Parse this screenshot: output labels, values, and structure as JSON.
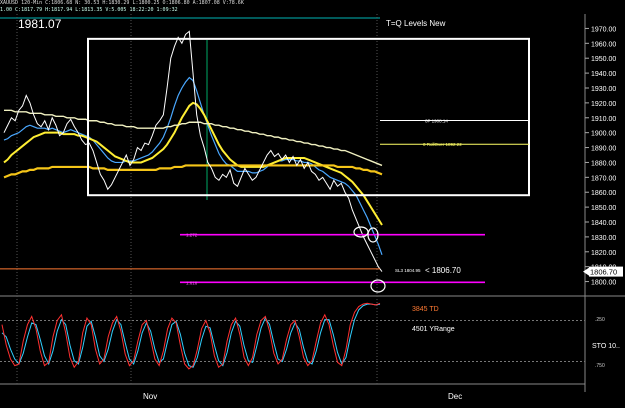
{
  "header": {
    "line1": "XAUUSD  120-Min  C:1806.68  N:  30.53  H:1830.29  L:1800.25  O:1806.80  A:1807.08  V:78.6K",
    "line2": "1.00  C:1817.79  H:1817.94  L:1813.35  V:5.005  18:22:20  1:09:32",
    "big_label": "1981.07",
    "title": "T=Q Levels New"
  },
  "colors": {
    "price": "#ffffff",
    "ma_fast": "#4aa8ff",
    "ma_mid": "#ffee33",
    "ma_slow": "#f5c518",
    "ma_long": "#f0f0c0",
    "fib_line": "#ff00ff",
    "zone_border": "#ffffff",
    "stoch_k": "#ff3030",
    "stoch_d": "#30d0ff"
  },
  "chart_data": {
    "type": "line",
    "y_axis": {
      "ticks": [
        "1970.00",
        "1960.00",
        "1950.00",
        "1940.00",
        "1930.00",
        "1920.00",
        "1910.00",
        "1900.00",
        "1890.00",
        "1880.00",
        "1870.00",
        "1860.00",
        "1850.00",
        "1840.00",
        "1830.00",
        "1820.00",
        "1810.00",
        "1800.00"
      ],
      "ylim": [
        1793,
        1977
      ]
    },
    "x_axis": {
      "ticks": [
        "Nov",
        "Dec"
      ]
    },
    "price_series": [
      1900,
      1905,
      1910,
      1908,
      1915,
      1918,
      1925,
      1920,
      1912,
      1906,
      1904,
      1908,
      1902,
      1910,
      1905,
      1898,
      1900,
      1906,
      1909,
      1904,
      1900,
      1895,
      1892,
      1893,
      1888,
      1880,
      1872,
      1868,
      1862,
      1865,
      1870,
      1875,
      1880,
      1885,
      1878,
      1882,
      1890,
      1888,
      1893,
      1892,
      1898,
      1905,
      1908,
      1912,
      1930,
      1950,
      1958,
      1964,
      1960,
      1966,
      1968,
      1940,
      1912,
      1898,
      1890,
      1880,
      1876,
      1870,
      1868,
      1872,
      1870,
      1875,
      1866,
      1864,
      1870,
      1876,
      1872,
      1868,
      1870,
      1875,
      1880,
      1885,
      1888,
      1884,
      1886,
      1882,
      1885,
      1880,
      1884,
      1878,
      1882,
      1876,
      1880,
      1874,
      1872,
      1868,
      1870,
      1866,
      1862,
      1868,
      1864,
      1866,
      1860,
      1856,
      1848,
      1842,
      1836,
      1830,
      1825,
      1820,
      1815,
      1810,
      1806.7
    ],
    "series": [
      {
        "name": "",
        "values": [
          1895,
          1896,
          1898,
          1899,
          1900,
          1902,
          1904,
          1905,
          1904,
          1903,
          1903,
          1903,
          1902,
          1903,
          1902,
          1901,
          1900,
          1901,
          1902,
          1901,
          1900,
          1899,
          1898,
          1897,
          1895,
          1892,
          1889,
          1886,
          1883,
          1881,
          1880,
          1880,
          1880,
          1881,
          1881,
          1881,
          1882,
          1883,
          1884,
          1885,
          1887,
          1890,
          1893,
          1897,
          1903,
          1910,
          1918,
          1925,
          1930,
          1934,
          1937,
          1935,
          1928,
          1920,
          1912,
          1905,
          1898,
          1892,
          1886,
          1882,
          1879,
          1878,
          1876,
          1874,
          1874,
          1874,
          1874,
          1873,
          1873,
          1874,
          1875,
          1877,
          1879,
          1880,
          1881,
          1881,
          1882,
          1882,
          1882,
          1881,
          1881,
          1880,
          1880,
          1879,
          1877,
          1875,
          1874,
          1872,
          1870,
          1869,
          1868,
          1867,
          1866,
          1864,
          1861,
          1858,
          1853,
          1848,
          1843,
          1837,
          1831,
          1825,
          1818
        ]
      },
      {
        "name": "",
        "values": [
          1880,
          1882,
          1885,
          1887,
          1889,
          1891,
          1893,
          1895,
          1897,
          1898,
          1899,
          1900,
          1900,
          1900,
          1900,
          1900,
          1899,
          1899,
          1899,
          1899,
          1898,
          1898,
          1897,
          1896,
          1895,
          1894,
          1892,
          1890,
          1888,
          1886,
          1884,
          1883,
          1882,
          1881,
          1880,
          1880,
          1880,
          1880,
          1881,
          1882,
          1883,
          1885,
          1887,
          1889,
          1892,
          1896,
          1900,
          1905,
          1910,
          1914,
          1918,
          1920,
          1919,
          1916,
          1912,
          1907,
          1902,
          1897,
          1892,
          1888,
          1885,
          1882,
          1880,
          1878,
          1877,
          1877,
          1877,
          1877,
          1877,
          1877,
          1877,
          1878,
          1879,
          1880,
          1881,
          1882,
          1883,
          1883,
          1883,
          1883,
          1883,
          1883,
          1882,
          1881,
          1880,
          1879,
          1878,
          1877,
          1876,
          1875,
          1874,
          1873,
          1871,
          1869,
          1867,
          1864,
          1861,
          1858,
          1854,
          1850,
          1846,
          1842,
          1838
        ]
      },
      {
        "name": "",
        "values": [
          1870,
          1871,
          1872,
          1872,
          1873,
          1874,
          1874,
          1875,
          1875,
          1876,
          1876,
          1876,
          1876,
          1877,
          1877,
          1877,
          1877,
          1877,
          1877,
          1877,
          1877,
          1877,
          1877,
          1877,
          1876,
          1876,
          1876,
          1876,
          1875,
          1875,
          1875,
          1875,
          1875,
          1875,
          1875,
          1875,
          1875,
          1875,
          1875,
          1875,
          1875,
          1875,
          1876,
          1876,
          1876,
          1876,
          1877,
          1877,
          1877,
          1878,
          1878,
          1878,
          1878,
          1878,
          1878,
          1878,
          1878,
          1878,
          1878,
          1878,
          1878,
          1878,
          1878,
          1878,
          1878,
          1878,
          1878,
          1878,
          1878,
          1878,
          1878,
          1878,
          1878,
          1878,
          1878,
          1878,
          1878,
          1878,
          1878,
          1878,
          1878,
          1878,
          1878,
          1878,
          1878,
          1878,
          1878,
          1878,
          1878,
          1878,
          1877,
          1877,
          1877,
          1877,
          1877,
          1876,
          1876,
          1875,
          1875,
          1874,
          1874,
          1873,
          1872
        ]
      },
      {
        "name": "",
        "values": [
          1915,
          1915,
          1915,
          1914,
          1914,
          1914,
          1914,
          1913,
          1913,
          1913,
          1913,
          1912,
          1912,
          1912,
          1911,
          1911,
          1911,
          1910,
          1910,
          1910,
          1909,
          1909,
          1909,
          1908,
          1908,
          1908,
          1907,
          1907,
          1906,
          1906,
          1905,
          1905,
          1905,
          1904,
          1904,
          1904,
          1903,
          1903,
          1903,
          1903,
          1903,
          1903,
          1903,
          1903,
          1904,
          1904,
          1905,
          1905,
          1906,
          1906,
          1907,
          1907,
          1907,
          1907,
          1906,
          1906,
          1906,
          1905,
          1905,
          1904,
          1904,
          1903,
          1903,
          1902,
          1902,
          1901,
          1901,
          1900,
          1900,
          1899,
          1899,
          1898,
          1898,
          1897,
          1897,
          1896,
          1896,
          1895,
          1895,
          1894,
          1894,
          1893,
          1893,
          1892,
          1892,
          1891,
          1891,
          1890,
          1890,
          1889,
          1889,
          1888,
          1888,
          1887,
          1886,
          1885,
          1884,
          1883,
          1882,
          1881,
          1880,
          1879,
          1878
        ]
      }
    ],
    "zone": {
      "top": 1963,
      "bottom": 1858
    },
    "levels": [
      {
        "value": 1908.14,
        "label": "0P 1908.14",
        "color": "#ffffff"
      },
      {
        "value": 1892.22,
        "label": "0 RollOver 1892.22",
        "color": "#ffff66"
      },
      {
        "value": 1831.5,
        "label": "1.272",
        "color": "#ff00ff"
      },
      {
        "value": 1808.5,
        "label": "",
        "color": "#ff7a33"
      },
      {
        "value": 1799.5,
        "label": "1.618",
        "color": "#ff00ff"
      }
    ],
    "annotations": {
      "sl_label": "SL3 1804.95",
      "current_price_label": "< 1806.70",
      "current_price_box": "1806.70"
    },
    "indicator": {
      "label_1": "3845 TD",
      "label_2": "4501 YRange",
      "name": "STO 10..",
      "ticks": [
        ".250",
        ".750"
      ],
      "k_values": [
        30,
        55,
        72,
        80,
        78,
        50,
        30,
        20,
        35,
        62,
        80,
        76,
        45,
        25,
        18,
        40,
        70,
        82,
        75,
        40,
        22,
        30,
        60,
        78,
        72,
        45,
        28,
        20,
        38,
        66,
        80,
        74,
        50,
        30,
        25,
        48,
        72,
        80,
        62,
        35,
        22,
        28,
        55,
        78,
        84,
        80,
        60,
        35,
        25,
        40,
        68,
        82,
        78,
        50,
        30,
        22,
        42,
        70,
        80,
        70,
        42,
        25,
        20,
        38,
        65,
        78,
        72,
        48,
        30,
        25,
        45,
        70,
        80,
        74,
        50,
        28,
        18,
        30,
        55,
        76,
        80,
        60,
        30,
        15,
        8,
        5,
        4,
        5,
        6,
        4
      ],
      "d_values": [
        40,
        45,
        60,
        72,
        78,
        65,
        45,
        28,
        30,
        48,
        68,
        78,
        62,
        38,
        24,
        30,
        55,
        74,
        78,
        58,
        32,
        26,
        45,
        68,
        75,
        60,
        38,
        24,
        30,
        52,
        72,
        78,
        62,
        40,
        28,
        38,
        60,
        76,
        72,
        50,
        30,
        26,
        42,
        65,
        80,
        82,
        70,
        48,
        32,
        34,
        55,
        74,
        80,
        64,
        40,
        26,
        32,
        56,
        74,
        76,
        56,
        34,
        22,
        30,
        52,
        72,
        75,
        60,
        40,
        28,
        36,
        58,
        75,
        78,
        62,
        40,
        24,
        24,
        42,
        64,
        78,
        70,
        45,
        24,
        12,
        7,
        5,
        5,
        6,
        5
      ]
    }
  }
}
